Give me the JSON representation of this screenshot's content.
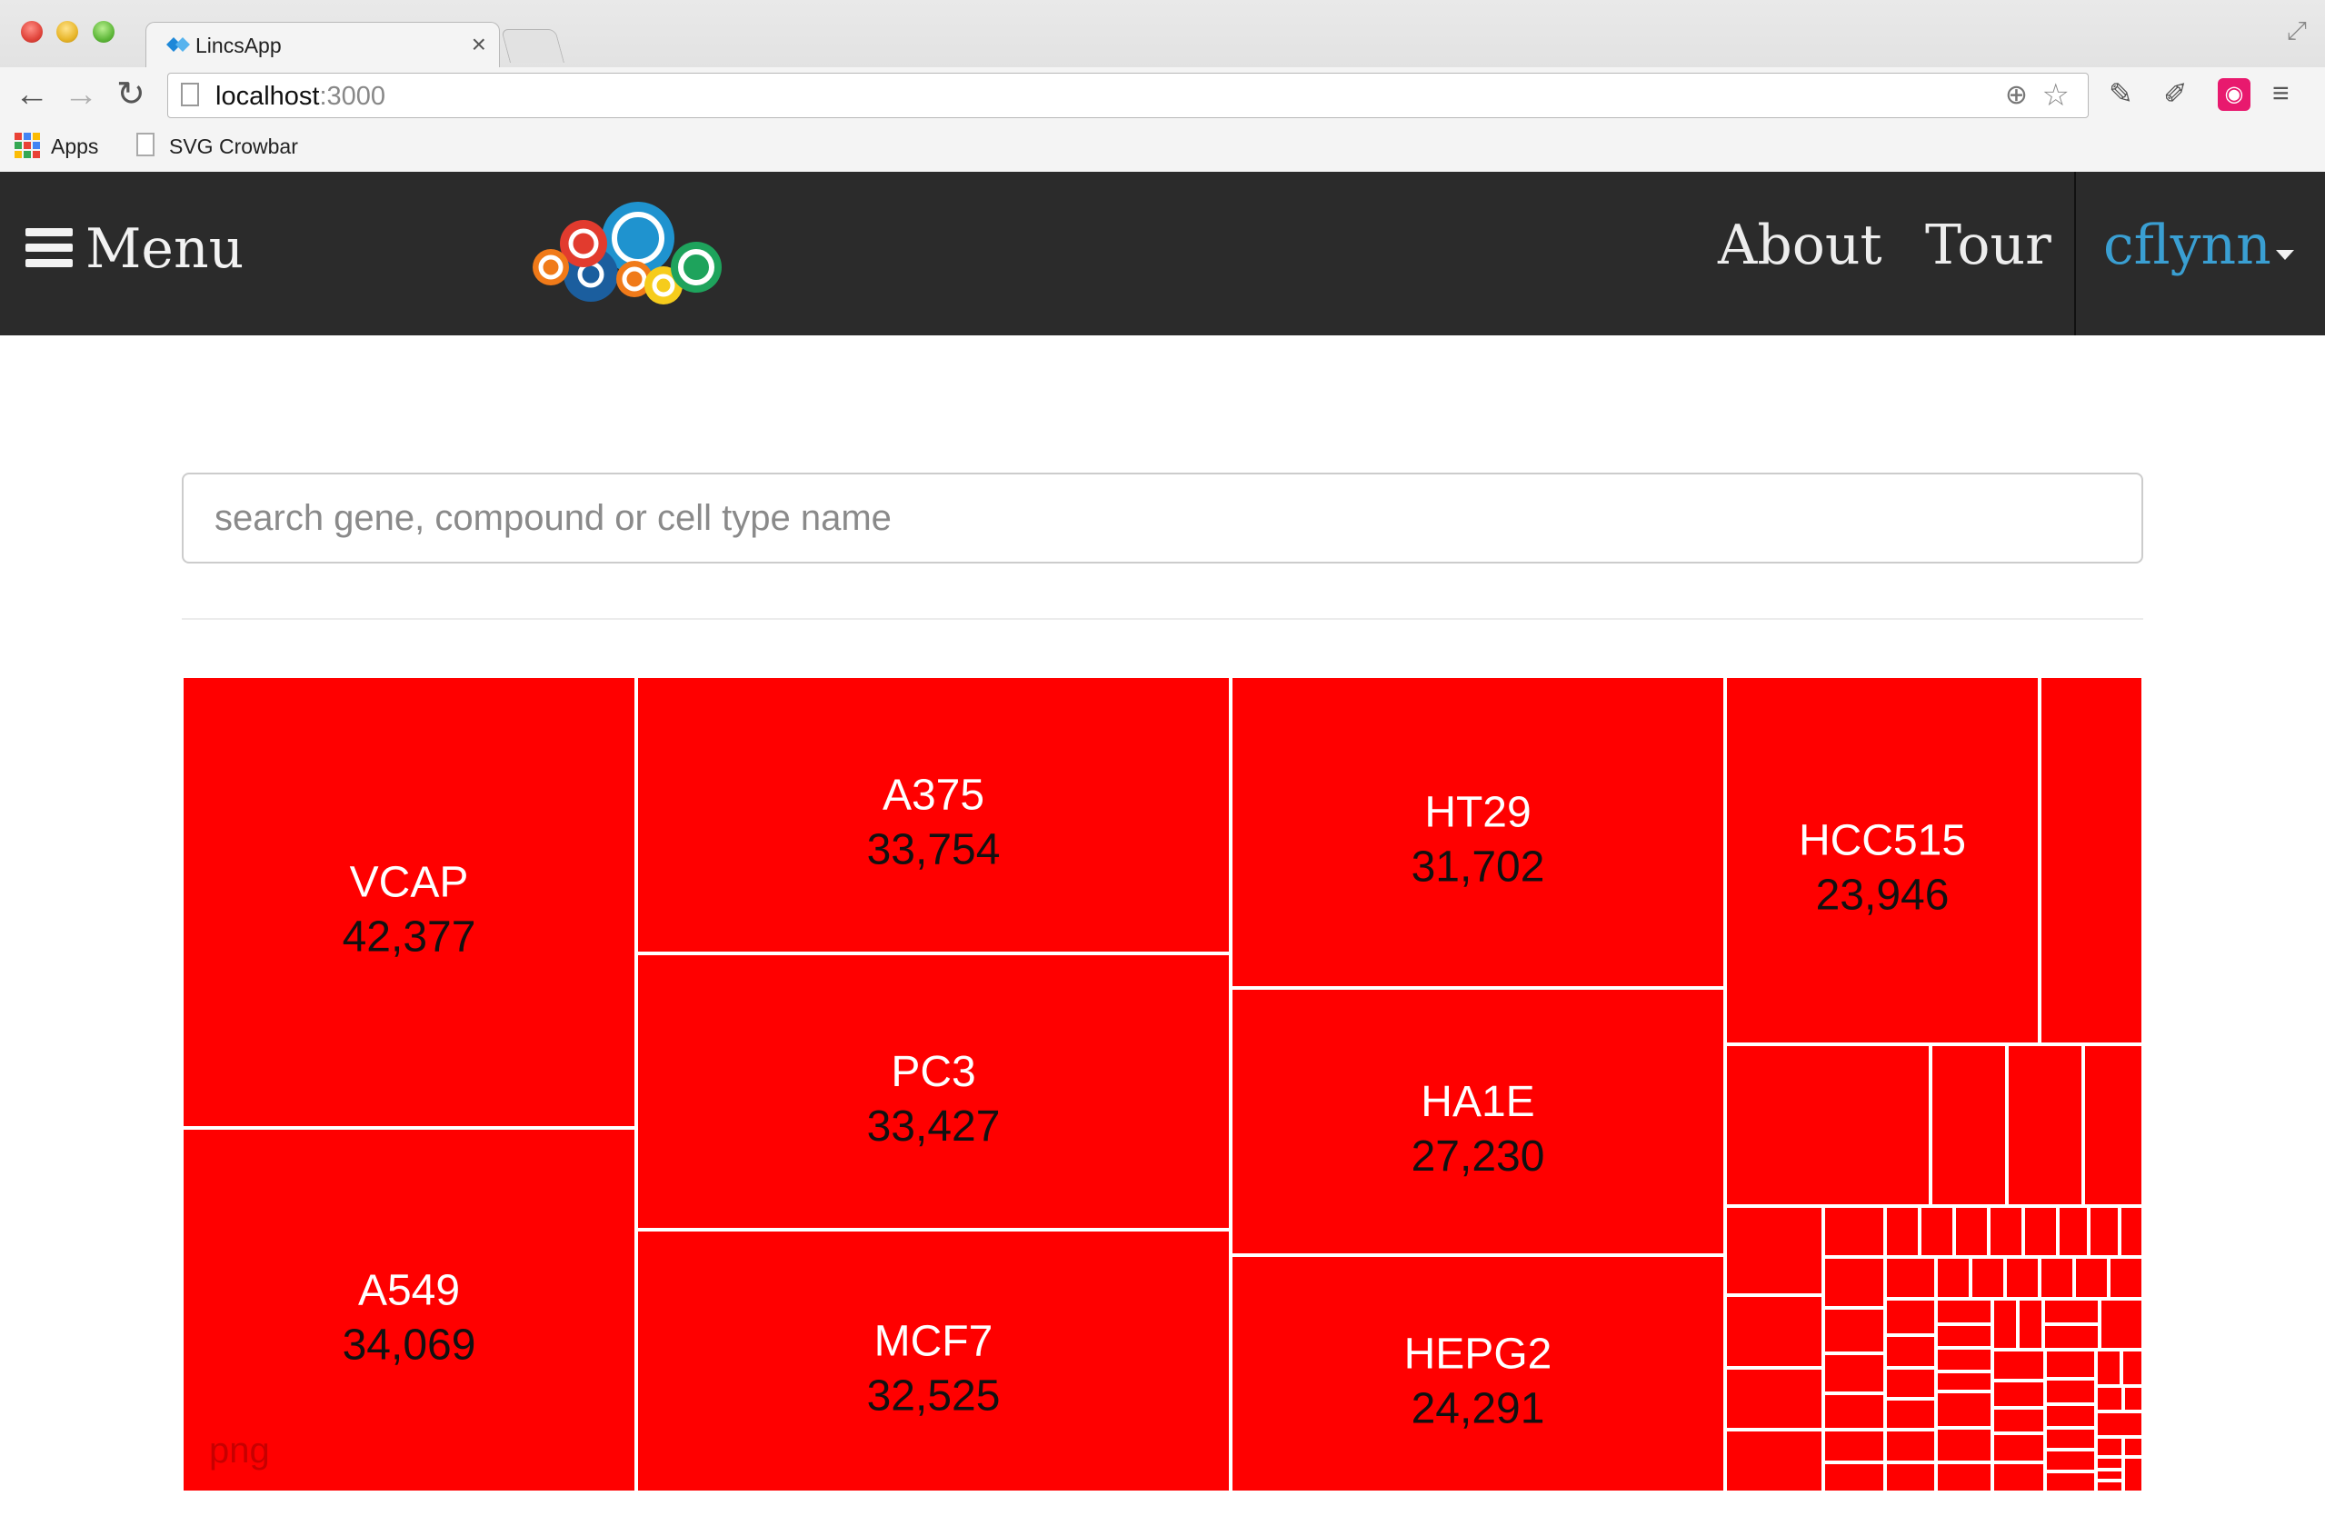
{
  "browser": {
    "tab_title": "LincsApp",
    "tab_close": "×",
    "url_host": "localhost",
    "url_port": ":3000",
    "bookmarks": [
      {
        "label": "Apps",
        "icon": "apps-grid-icon"
      },
      {
        "label": "SVG Crowbar",
        "icon": "page-icon"
      }
    ],
    "icons": {
      "back": "←",
      "forward": "→",
      "reload": "↻",
      "zoom": "⊕",
      "star": "☆",
      "menu": "≡"
    }
  },
  "navbar": {
    "menu_label": "Menu",
    "links": [
      "About",
      "Tour"
    ],
    "user": "cflynn",
    "colors": {
      "background": "#2b2b2b",
      "user": "#3a9fd2"
    }
  },
  "search": {
    "placeholder": "search gene, compound or cell type name",
    "value": ""
  },
  "png_label": "png",
  "chart_data": {
    "type": "treemap",
    "fill": "#ff0000",
    "cells": [
      {
        "label": "VCAP",
        "value": "42,377"
      },
      {
        "label": "A549",
        "value": "34,069"
      },
      {
        "label": "A375",
        "value": "33,754"
      },
      {
        "label": "PC3",
        "value": "33,427"
      },
      {
        "label": "MCF7",
        "value": "32,525"
      },
      {
        "label": "HT29",
        "value": "31,702"
      },
      {
        "label": "HA1E",
        "value": "27,230"
      },
      {
        "label": "HEPG2",
        "value": "24,291"
      },
      {
        "label": "HCC515",
        "value": "23,946"
      }
    ]
  }
}
